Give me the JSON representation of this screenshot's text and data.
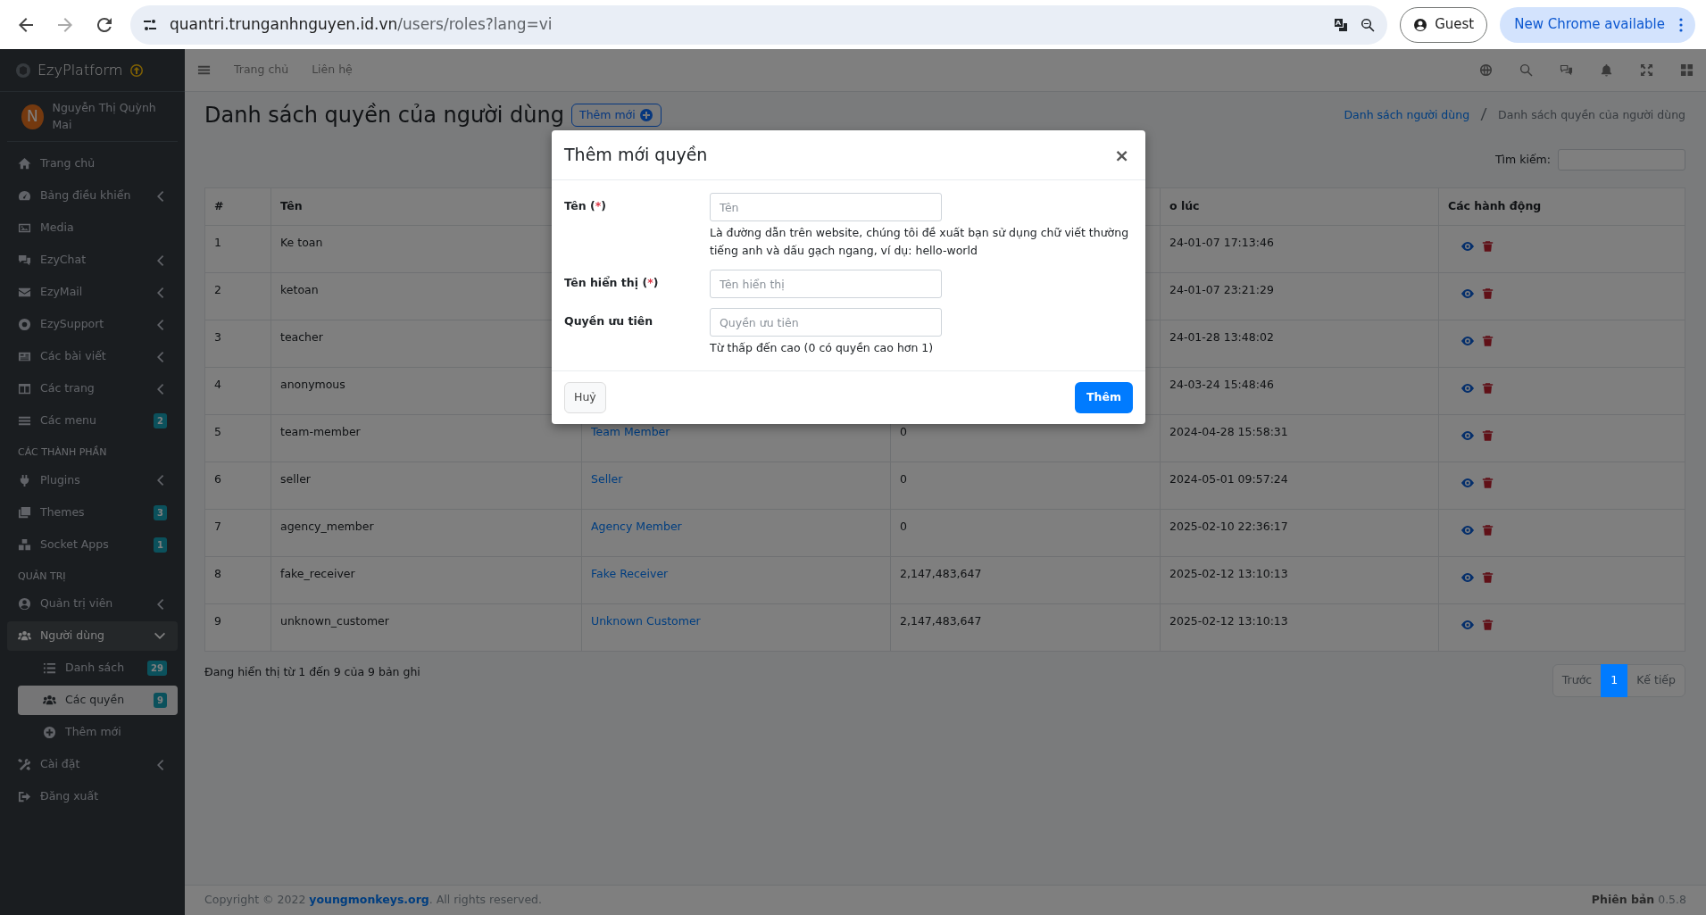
{
  "browser": {
    "url_host": "quantri.trunganhnguyen.id.vn",
    "url_path": "/users/roles?lang=vi",
    "profile": "Guest",
    "update": "New Chrome available"
  },
  "brand": {
    "name": "EzyPlatform"
  },
  "user": {
    "avatar_letter": "N",
    "name": "Nguyễn Thị Quỳnh Mai"
  },
  "sidebar": {
    "items": [
      {
        "kind": "link",
        "label": "Trang chủ",
        "selected": false
      },
      {
        "kind": "group",
        "label": "Bảng điều khiển",
        "expanded": false,
        "selected": false
      },
      {
        "kind": "link",
        "label": "Media",
        "selected": false
      },
      {
        "kind": "group",
        "label": "EzyChat",
        "expanded": false,
        "selected": false
      },
      {
        "kind": "group",
        "label": "EzyMail",
        "expanded": false,
        "selected": false
      },
      {
        "kind": "group",
        "label": "EzySupport",
        "expanded": false,
        "selected": false
      },
      {
        "kind": "group",
        "label": "Các bài viết",
        "expanded": false,
        "selected": false
      },
      {
        "kind": "group",
        "label": "Các trang",
        "expanded": false,
        "selected": false
      },
      {
        "kind": "link",
        "label": "Các menu",
        "badge": "2",
        "selected": false
      },
      {
        "kind": "header",
        "label": "CÁC THÀNH PHẦN"
      },
      {
        "kind": "group",
        "label": "Plugins",
        "expanded": false,
        "selected": false
      },
      {
        "kind": "link",
        "label": "Themes",
        "badge": "3",
        "selected": false
      },
      {
        "kind": "link",
        "label": "Socket Apps",
        "badge": "1",
        "selected": false
      },
      {
        "kind": "header",
        "label": "QUẢN TRỊ"
      },
      {
        "kind": "group",
        "label": "Quản trị viên",
        "expanded": false,
        "selected": false
      },
      {
        "kind": "group",
        "label": "Người dùng",
        "expanded": true,
        "selected": false,
        "children": [
          {
            "kind": "link",
            "label": "Danh sách",
            "badge": "29",
            "selected": false
          },
          {
            "kind": "link",
            "label": "Các quyền",
            "badge": "9",
            "selected": true
          },
          {
            "kind": "link",
            "label": "Thêm mới",
            "selected": false
          }
        ]
      },
      {
        "kind": "group",
        "label": "Cài đặt",
        "expanded": false,
        "selected": false
      },
      {
        "kind": "link",
        "label": "Đăng xuất",
        "selected": false
      }
    ]
  },
  "topnav": {
    "links": [
      "Trang chủ",
      "Liên hệ"
    ]
  },
  "page": {
    "title": "Danh sách quyền của người dùng",
    "add_button": "Thêm mới",
    "breadcrumb": [
      "Danh sách người dùng",
      "Danh sách quyền của người dùng"
    ],
    "search_label": "Tìm kiếm:"
  },
  "table": {
    "columns": [
      {
        "label": "#"
      },
      {
        "label": "Tên"
      },
      {},
      {},
      {
        "label": "o lúc"
      },
      {
        "label": "Các hành động"
      }
    ],
    "rows": [
      {
        "index": "1",
        "name": "Ke toan",
        "created": "24-01-07 17:13:46"
      },
      {
        "index": "2",
        "name": "ketoan",
        "created": "24-01-07 23:21:29"
      },
      {
        "index": "3",
        "name": "teacher",
        "created": "24-01-28 13:48:02"
      },
      {
        "index": "4",
        "name": "anonymous",
        "created": "24-03-24 15:48:46"
      },
      {
        "index": "5",
        "name": "team-member",
        "display_name": "Team Member",
        "priority": "0",
        "created": "2024-04-28 15:58:31"
      },
      {
        "index": "6",
        "name": "seller",
        "display_name": "Seller",
        "priority": "0",
        "created": "2024-05-01 09:57:24"
      },
      {
        "index": "7",
        "name": "agency_member",
        "display_name": "Agency Member",
        "priority": "0",
        "created": "2025-02-10 22:36:17"
      },
      {
        "index": "8",
        "name": "fake_receiver",
        "display_name": "Fake Receiver",
        "priority": "2,147,483,647",
        "created": "2025-02-12 13:10:13"
      },
      {
        "index": "9",
        "name": "unknown_customer",
        "display_name": "Unknown Customer",
        "priority": "2,147,483,647",
        "created": "2025-02-12 13:10:13"
      }
    ]
  },
  "info": "Đang hiển thị từ 1 đến 9 của 9 bản ghi",
  "pagination": [
    {
      "label": "Trước",
      "selected": false
    },
    {
      "label": "1",
      "selected": true
    },
    {
      "label": "Kế tiếp",
      "selected": false
    }
  ],
  "footer": {
    "copyright": "Copyright © 2022",
    "link": "youngmonkeys.org",
    "rest": ". All rights reserved.",
    "version_label": "Phiên bản",
    "version": "0.5.8"
  },
  "modal": {
    "title": "Thêm mới quyền",
    "close": "×",
    "fields": [
      {
        "label": "Tên",
        "required_mark": "(*)",
        "placeholder": "Tên",
        "help": "Là đường dẫn trên website, chúng tôi đề xuất bạn sử dụng chữ viết thường tiếng anh và dấu gạch ngang, ví dụ: hello-world"
      },
      {
        "label": "Tên hiển thị",
        "required_mark": "(*)",
        "placeholder": "Tên hiển thị"
      },
      {
        "label": "Quyền ưu tiên",
        "placeholder": "Quyền ưu tiên",
        "help": "Từ thấp đến cao (0 có quyền cao hơn 1)"
      }
    ],
    "cancel": "Huỷ",
    "submit": "Thêm"
  }
}
